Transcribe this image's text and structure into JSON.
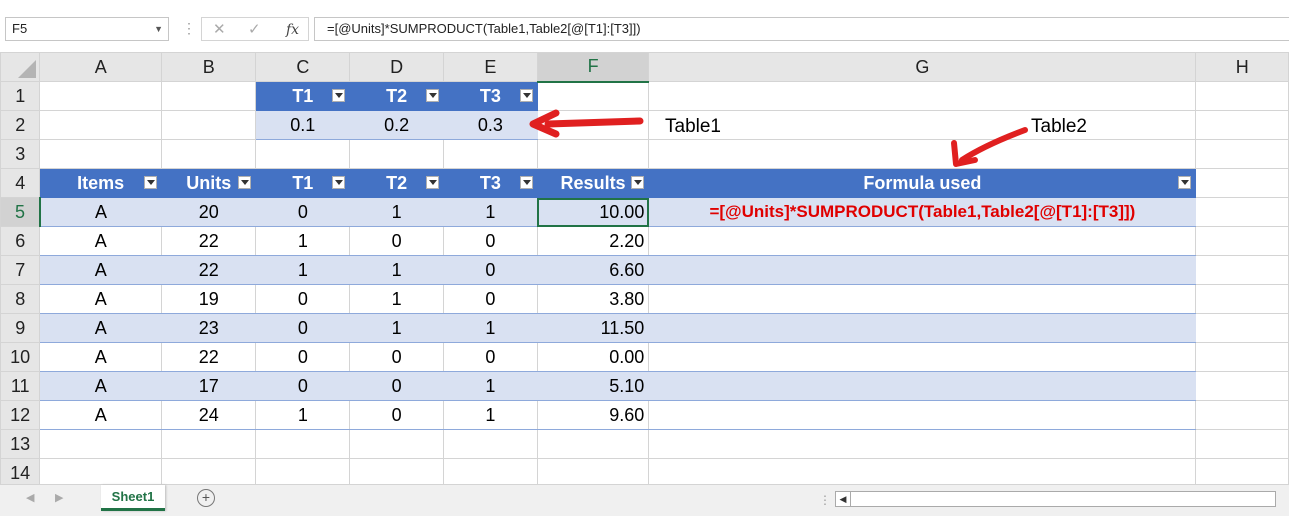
{
  "formula_bar": {
    "name_box": "F5",
    "cancel_glyph": "✕",
    "enter_glyph": "✓",
    "fx_label": "fx",
    "formula": "=[@Units]*SUMPRODUCT(Table1,Table2[@[T1]:[T3]])"
  },
  "columns": [
    "A",
    "B",
    "C",
    "D",
    "E",
    "F",
    "G",
    "H"
  ],
  "rows": [
    "1",
    "2",
    "3",
    "4",
    "5",
    "6",
    "7",
    "8",
    "9",
    "10",
    "11",
    "12",
    "13",
    "14"
  ],
  "table1": {
    "headers": [
      "T1",
      "T2",
      "T3"
    ],
    "values": [
      "0.1",
      "0.2",
      "0.3"
    ]
  },
  "table2": {
    "headers": [
      "Items",
      "Units",
      "T1",
      "T2",
      "T3",
      "Results",
      "Formula used"
    ],
    "rows": [
      {
        "items": "A",
        "units": "20",
        "t1": "0",
        "t2": "1",
        "t3": "1",
        "results": "10.00",
        "formula": "=[@Units]*SUMPRODUCT(Table1,Table2[@[T1]:[T3]])"
      },
      {
        "items": "A",
        "units": "22",
        "t1": "1",
        "t2": "0",
        "t3": "0",
        "results": "2.20",
        "formula": ""
      },
      {
        "items": "A",
        "units": "22",
        "t1": "1",
        "t2": "1",
        "t3": "0",
        "results": "6.60",
        "formula": ""
      },
      {
        "items": "A",
        "units": "19",
        "t1": "0",
        "t2": "1",
        "t3": "0",
        "results": "3.80",
        "formula": ""
      },
      {
        "items": "A",
        "units": "23",
        "t1": "0",
        "t2": "1",
        "t3": "1",
        "results": "11.50",
        "formula": ""
      },
      {
        "items": "A",
        "units": "22",
        "t1": "0",
        "t2": "0",
        "t3": "0",
        "results": "0.00",
        "formula": ""
      },
      {
        "items": "A",
        "units": "17",
        "t1": "0",
        "t2": "0",
        "t3": "1",
        "results": "5.10",
        "formula": ""
      },
      {
        "items": "A",
        "units": "24",
        "t1": "1",
        "t2": "0",
        "t3": "1",
        "results": "9.60",
        "formula": ""
      }
    ]
  },
  "annotations": {
    "table1_label": "Table1",
    "table2_label": "Table2",
    "arrow_color": "#e02020"
  },
  "sheet_tabs": [
    "Sheet1"
  ],
  "colors": {
    "header_blue": "#4472c4",
    "band_blue": "#d9e1f2",
    "excel_green": "#217346",
    "formula_red": "#e00000"
  }
}
